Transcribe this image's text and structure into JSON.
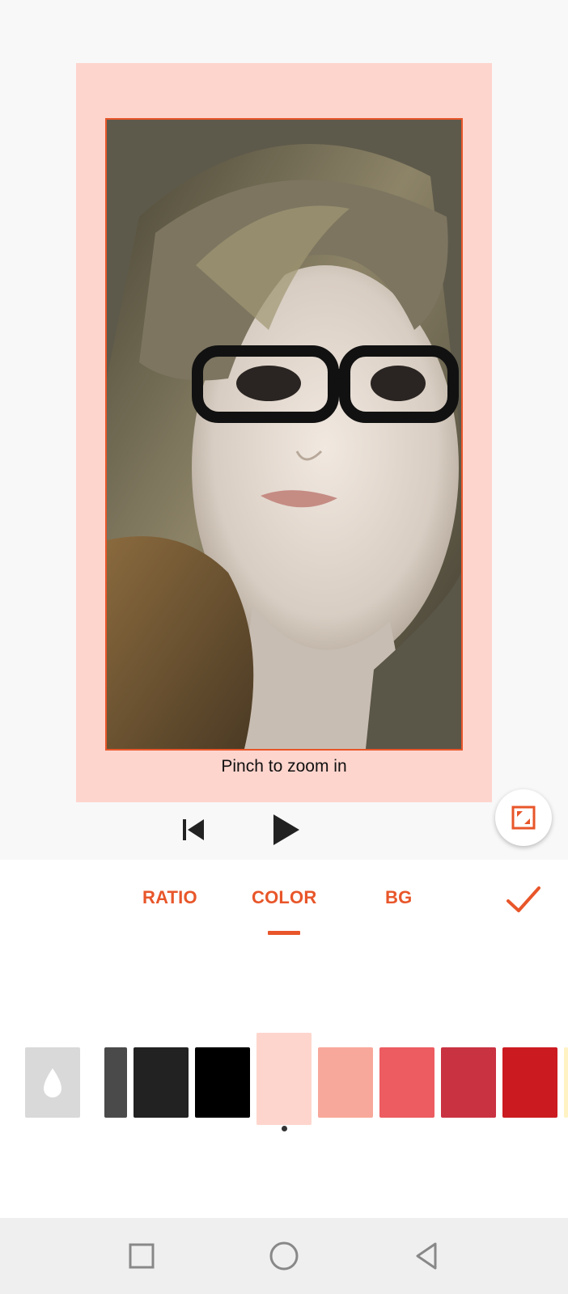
{
  "preview": {
    "hint_text": "Pinch to zoom in",
    "frame_color": "#fed5cd",
    "accent_color": "#e8562a"
  },
  "playback": {
    "previous_icon": "skip-previous-icon",
    "play_icon": "play-icon"
  },
  "expand_button": {
    "icon": "expand-icon"
  },
  "toolbar": {
    "tabs": [
      {
        "label": "RATIO"
      },
      {
        "label": "COLOR"
      },
      {
        "label": "BG"
      }
    ],
    "active_tab": "COLOR",
    "confirm_icon": "checkmark-icon"
  },
  "swatches": {
    "picker_icon": "color-drop-icon",
    "colors": [
      "#4a4a4a",
      "#222222",
      "#000000",
      "#fed5cd",
      "#f8a89a",
      "#ec5c61",
      "#c93241",
      "#cb1b20",
      "#fff3c4"
    ],
    "selected": "#fed5cd"
  },
  "nav": {
    "recent_icon": "square-recents-icon",
    "home_icon": "circle-home-icon",
    "back_icon": "triangle-back-icon"
  }
}
